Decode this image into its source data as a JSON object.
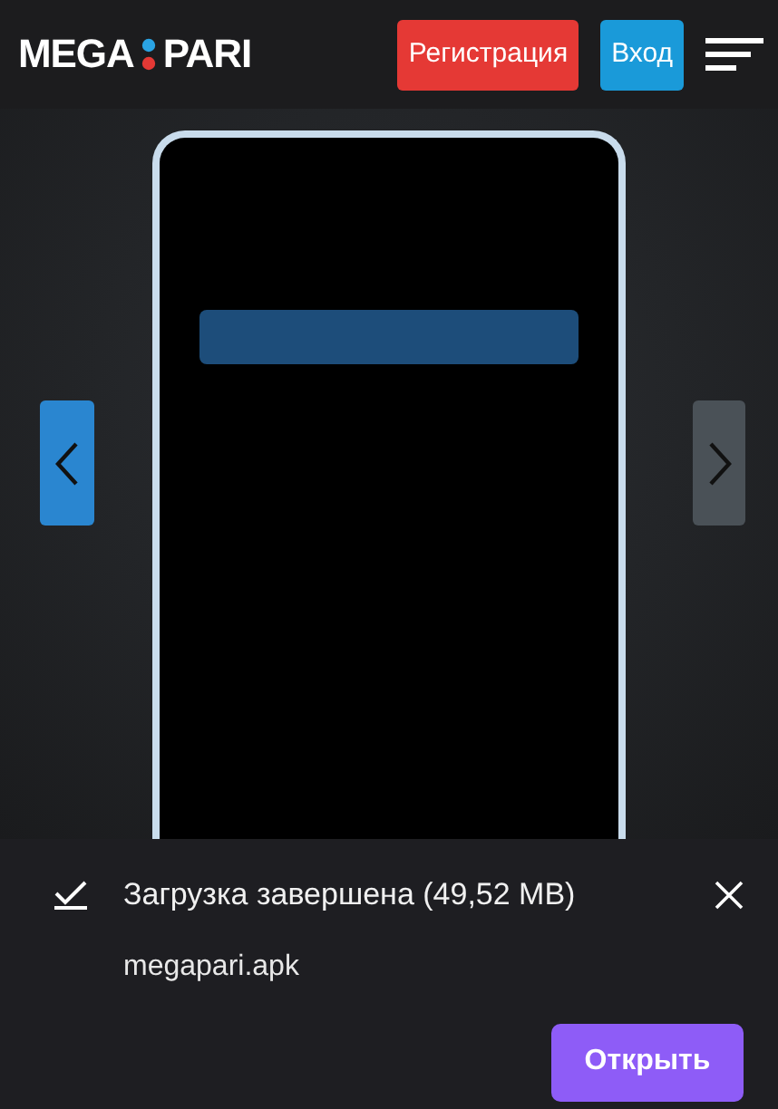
{
  "header": {
    "logo": {
      "left": "MEGA",
      "right": "PARI"
    },
    "register_button": "Регистрация",
    "login_button": "Вход"
  },
  "download_sheet": {
    "title": "Загрузка завершена (49,52 MB)",
    "file_name": "megapari.apk",
    "open_button": "Открыть"
  }
}
